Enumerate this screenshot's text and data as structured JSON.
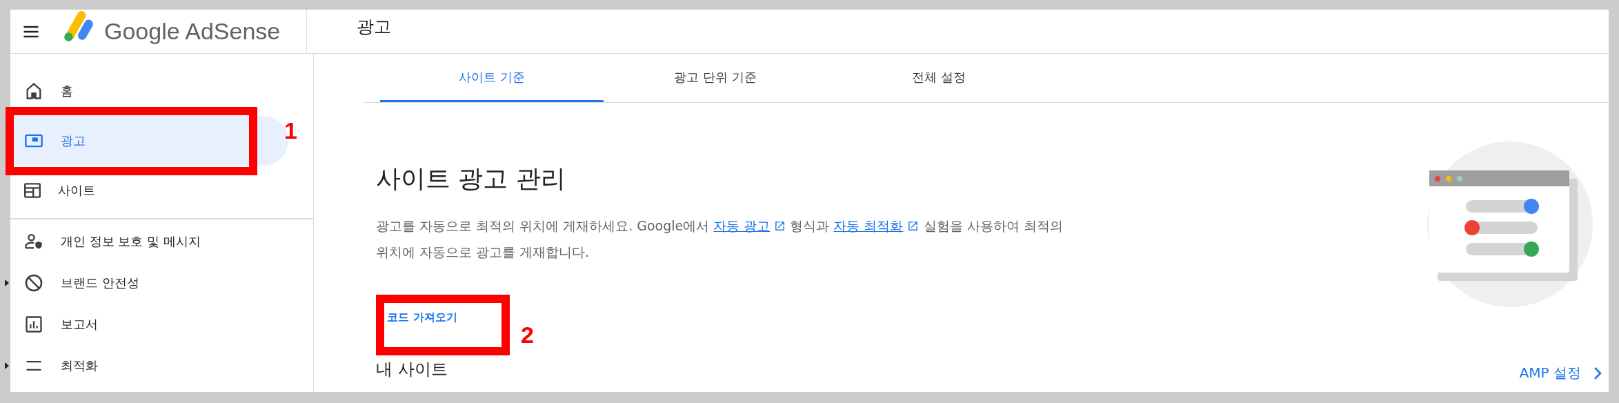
{
  "header": {
    "product": "Google AdSense",
    "page_title": "광고"
  },
  "sidebar": {
    "groups": [
      [
        {
          "label": "홈",
          "selected": false,
          "expandable": false
        },
        {
          "label": "광고",
          "selected": true,
          "expandable": false
        },
        {
          "label": "사이트",
          "selected": false,
          "expandable": false
        }
      ],
      [
        {
          "label": "개인 정보 보호 및 메시지",
          "selected": false,
          "expandable": false
        },
        {
          "label": "브랜드 안전성",
          "selected": false,
          "expandable": true
        },
        {
          "label": "보고서",
          "selected": false,
          "expandable": false
        },
        {
          "label": "최적화",
          "selected": false,
          "expandable": true
        }
      ]
    ]
  },
  "tabs": [
    {
      "label": "사이트 기준",
      "selected": true
    },
    {
      "label": "광고 단위 기준",
      "selected": false
    },
    {
      "label": "전체 설정",
      "selected": false
    }
  ],
  "content": {
    "title": "사이트 광고 관리",
    "description": [
      {
        "kind": "text",
        "text": "광고를 자동으로 최적의 위치에 게재하세요. Google에서 "
      },
      {
        "kind": "link",
        "text": "자동 광고"
      },
      {
        "kind": "text",
        "text": " 형식과 "
      },
      {
        "kind": "link",
        "text": "자동 최적화"
      },
      {
        "kind": "text",
        "text": " 실험을 사용하여 최적의 위치에 자동으로 광고를 게재합니다."
      }
    ],
    "get_code": "코드 가져오기",
    "my_sites": "내 사이트",
    "amp_settings": "AMP 설정"
  },
  "annotations": [
    {
      "label": "1"
    },
    {
      "label": "2"
    }
  ]
}
